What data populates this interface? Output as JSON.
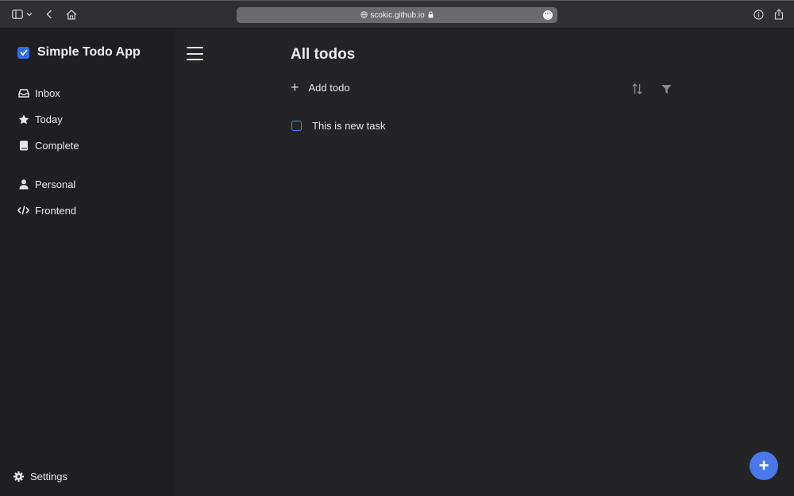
{
  "browser": {
    "url": "scokic.github.io",
    "icons": [
      "sidebar-toggle-icon",
      "chevron-down-icon",
      "back-icon",
      "home-icon",
      "globe-icon",
      "lock-icon",
      "more-icon",
      "info-icon",
      "share-icon"
    ]
  },
  "app": {
    "title": "Simple Todo App",
    "accent": "#2f6bea"
  },
  "sidebar": {
    "items": [
      {
        "label": "Inbox",
        "icon": "inbox-icon"
      },
      {
        "label": "Today",
        "icon": "star-icon"
      },
      {
        "label": "Complete",
        "icon": "book-icon"
      }
    ],
    "projects": [
      {
        "label": "Personal",
        "icon": "user-icon"
      },
      {
        "label": "Frontend",
        "icon": "code-icon"
      }
    ],
    "settings_label": "Settings"
  },
  "main": {
    "title": "All todos",
    "add_label": "Add todo",
    "tasks": [
      {
        "label": "This is new task",
        "done": false
      }
    ]
  },
  "fab": {
    "label": "+"
  }
}
